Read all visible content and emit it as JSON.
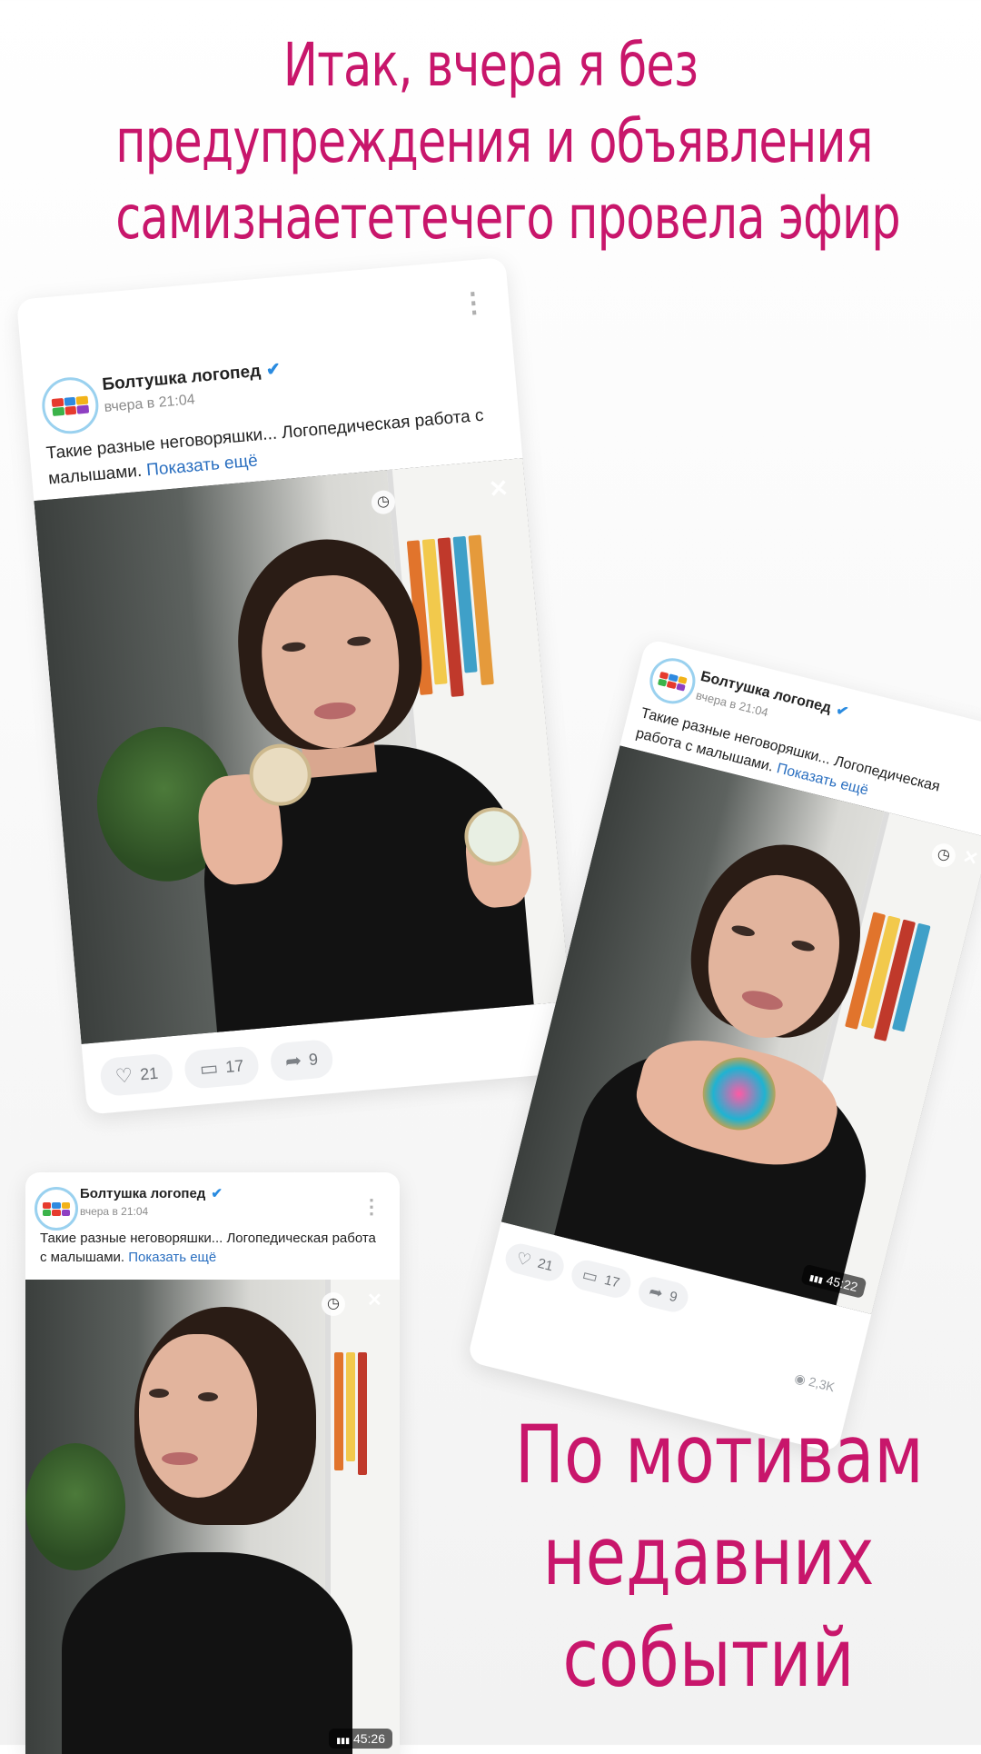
{
  "headline": {
    "line1": "Итак, вчера я без",
    "line2": "предупреждения и объявления",
    "line3": "самизнаететечего провела эфир"
  },
  "footer": {
    "line1": "По мотивам",
    "line2": "недавних",
    "line3": "событий"
  },
  "posts": [
    {
      "author": "Болтушка логопед",
      "time": "вчера в 21:04",
      "text": "Такие разные неговоряшки... Логопедическая работа с малышами.",
      "show_more": "Показать ещё",
      "likes": "21",
      "comments": "17",
      "shares": "9"
    },
    {
      "author": "Болтушка логопед",
      "time": "вчера в 21:04",
      "text": "Такие разные неговоряшки... Логопедическая работа с малышами.",
      "show_more": "Показать ещё",
      "likes": "21",
      "comments": "17",
      "shares": "9",
      "duration": "45:22",
      "views": "2,3K"
    },
    {
      "author": "Болтушка логопед",
      "time": "вчера в 21:04",
      "text": "Такие разные неговоряшки... Логопедическая работа с малышами.",
      "show_more": "Показать ещё",
      "duration": "45:26"
    }
  ],
  "icons": {
    "verified": "✔",
    "more": "⋮",
    "clock": "◷",
    "mute": "✕",
    "like": "♡",
    "comment": "▭",
    "share": "➦",
    "views": "◉",
    "bars": "▮▮▮"
  },
  "colors": {
    "accent": "#c8166b",
    "link": "#2a6fc0",
    "verified": "#2a8be0"
  }
}
